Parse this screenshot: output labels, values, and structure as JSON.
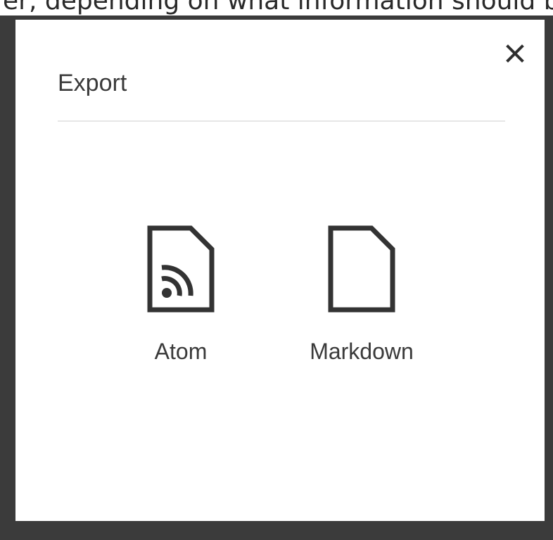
{
  "background_text": "er, depending on what information should be",
  "dialog": {
    "title": "Export",
    "close_label": "×",
    "options": [
      {
        "label": "Atom",
        "icon": "rss-document-icon"
      },
      {
        "label": "Markdown",
        "icon": "document-icon"
      }
    ]
  },
  "colors": {
    "overlay": "#3b3b3b",
    "dialog_bg": "#ffffff",
    "text": "#3a3a3a",
    "divider": "#e6e6e6"
  }
}
